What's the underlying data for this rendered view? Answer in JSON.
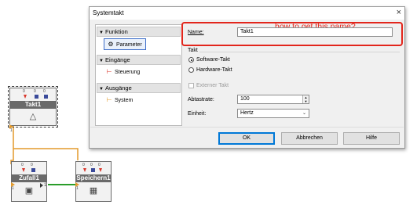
{
  "diagram": {
    "blocks": [
      {
        "title": "Takt1",
        "icon": "metronome-icon",
        "pin_numbers": [
          "0",
          "0",
          "0"
        ],
        "input_number": "1"
      },
      {
        "title": "Zufall1",
        "icon": "dice-icon",
        "pin_numbers": [
          "0",
          "0"
        ],
        "input_number": "1",
        "output_number": "1"
      },
      {
        "title": "Speichern1",
        "icon": "save-icon",
        "pin_numbers": [
          "0",
          "0",
          "0"
        ],
        "input_number": "1"
      }
    ]
  },
  "dialog": {
    "title": "Systemtakt",
    "close_glyph": "×",
    "nav": {
      "groups": [
        {
          "label": "Funktion",
          "items": [
            {
              "label": "Parameter",
              "icon": "gear-icon"
            }
          ]
        },
        {
          "label": "Eingänge",
          "items": [
            {
              "label": "Steuerung",
              "icon": "input-connector-icon"
            }
          ]
        },
        {
          "label": "Ausgänge",
          "items": [
            {
              "label": "System",
              "icon": "output-connector-icon"
            }
          ]
        }
      ],
      "selected": "Parameter"
    },
    "annotation": "how to get this name?",
    "name_label": "Name:",
    "name_value": "Takt1",
    "takt_section": "Takt",
    "radio_software": "Software-Takt",
    "radio_hardware": "Hardware-Takt",
    "selected_radio": "Software-Takt",
    "external_takt": "Externer Takt",
    "abtastrate_label": "Abtastrate:",
    "abtastrate_value": "100",
    "einheit_label": "Einheit:",
    "einheit_value": "Hertz",
    "ok_label": "OK",
    "cancel_label": "Abbrechen",
    "help_label": "Hilfe"
  },
  "colors": {
    "annotation_red": "#e2261c",
    "wire_orange": "#e39a2c",
    "wire_green": "#2a9d2a",
    "pin_red": "#d9372b",
    "pin_blue": "#3a4a9a",
    "block_title_bg": "#6a6a6a",
    "default_button_blue": "#0078d7"
  }
}
